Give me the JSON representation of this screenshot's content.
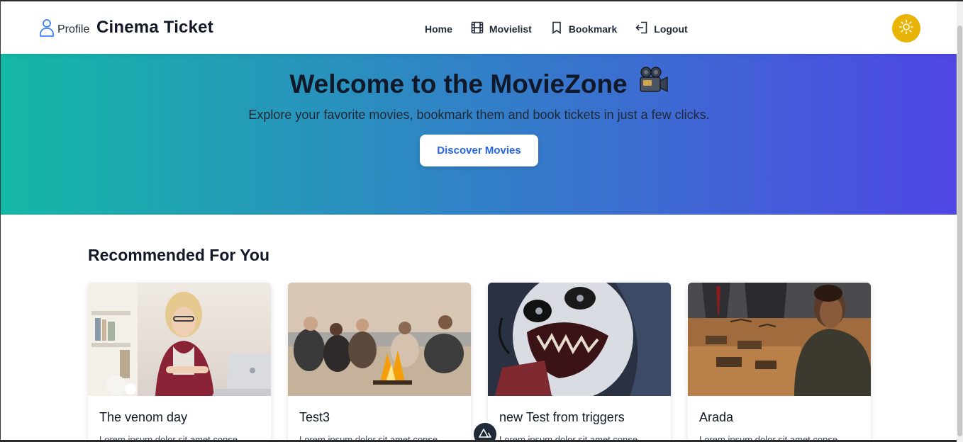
{
  "navbar": {
    "profile_label": "Profile",
    "brand": "Cinema Ticket",
    "links": [
      {
        "label": "Home"
      },
      {
        "label": "Movielist"
      },
      {
        "label": "Bookmark"
      },
      {
        "label": "Logout"
      }
    ],
    "theme_toggle_color": "#eab308"
  },
  "hero": {
    "title": "Welcome to the MovieZone",
    "subtitle": "Explore your favorite movies, bookmark them and book tickets in just a few clicks.",
    "button_label": "Discover Movies",
    "gradient": [
      "#14b8a6",
      "#4f46e5"
    ]
  },
  "recommended": {
    "title": "Recommended For You",
    "cards": [
      {
        "title": "The venom day",
        "description": "Lorem ipsum dolor sit amet conse"
      },
      {
        "title": "Test3",
        "description": "Lorem ipsum dolor sit amet conse"
      },
      {
        "title": "new Test from triggers",
        "description": "Lorem ipsum dolor sit amet conse"
      },
      {
        "title": "Arada",
        "description": "Lorem ipsum dolor sit amet conse"
      }
    ]
  },
  "colors": {
    "accent": "#2563eb",
    "text": "#111827"
  },
  "icons": [
    "user-icon",
    "film-icon",
    "bookmark-icon",
    "logout-icon",
    "sun-icon",
    "movie-camera-icon",
    "nuxt-devtools-icon"
  ]
}
